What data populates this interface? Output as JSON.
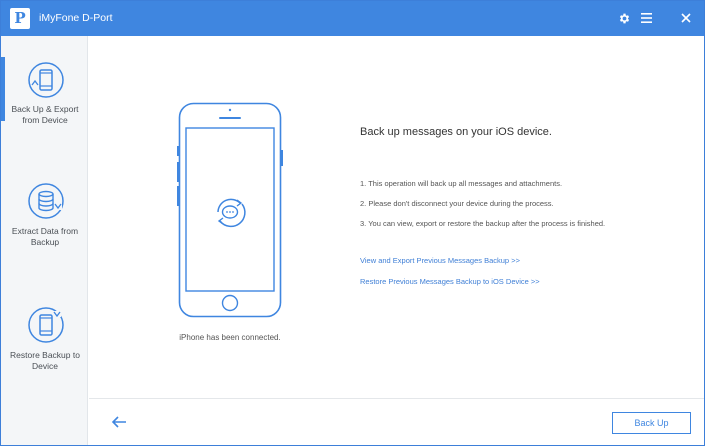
{
  "app": {
    "logo_letter": "P",
    "title": "iMyFone D-Port",
    "accent_color": "#3f86e0"
  },
  "titlebar": {
    "buttons": [
      "gear-icon",
      "menu-icon",
      "close-icon"
    ]
  },
  "sidebar": {
    "items": [
      {
        "label": "Back Up & Export from Device",
        "icon": "phone-backup-icon",
        "active": true
      },
      {
        "label": "Extract Data from Backup",
        "icon": "database-icon",
        "active": false
      },
      {
        "label": "Restore Backup to Device",
        "icon": "phone-restore-icon",
        "active": false
      }
    ]
  },
  "main": {
    "phone_status": "iPhone has been connected.",
    "headline": "Back up messages on your iOS device.",
    "steps": [
      "1. This operation will back up all messages and attachments.",
      "2. Please don't disconnect your device during the process.",
      "3. You can view, export or restore the backup after the process is finished."
    ],
    "links": [
      "View and Export Previous Messages Backup >>",
      "Restore Previous Messages Backup to iOS Device >>"
    ]
  },
  "footer": {
    "back_icon": "arrow-left-icon",
    "primary_button": "Back Up"
  }
}
